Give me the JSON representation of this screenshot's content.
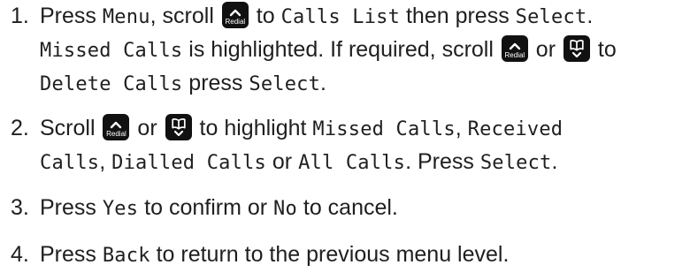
{
  "icons": {
    "redial_key": {
      "name": "redial-up-key-icon",
      "label": "Redial"
    },
    "phonebook_key": {
      "name": "phonebook-down-key-icon"
    }
  },
  "steps": [
    {
      "number": "1.",
      "line1": {
        "t1": "Press ",
        "menu": "Menu",
        "t2": ", scroll ",
        "t3": " to ",
        "calls_list": "Calls List",
        "t4": " then press ",
        "select": "Select",
        "t5": "."
      },
      "line2": {
        "missed_calls": "Missed Calls",
        "t1": " is highlighted. If required, scroll ",
        "t2": " or ",
        "t3": " to"
      },
      "line3": {
        "delete_calls": "Delete Calls",
        "t1": " press ",
        "select": "Select",
        "t2": "."
      }
    },
    {
      "number": "2.",
      "line1": {
        "t1": "Scroll ",
        "t2": " or ",
        "t3": " to highlight ",
        "missed_calls": "Missed Calls",
        "t4": ", ",
        "received": "Received"
      },
      "line2": {
        "calls": "Calls",
        "t1": ", ",
        "dialled_calls": "Dialled Calls",
        "t2": " or ",
        "all_calls": "All Calls",
        "t3": ". Press ",
        "select": "Select",
        "t4": "."
      }
    },
    {
      "number": "3.",
      "t1": "Press ",
      "yes": "Yes",
      "t2": " to confirm or ",
      "no": "No",
      "t3": " to cancel."
    },
    {
      "number": "4.",
      "t1": "Press ",
      "back": "Back",
      "t2": " to return to the previous menu level."
    }
  ]
}
